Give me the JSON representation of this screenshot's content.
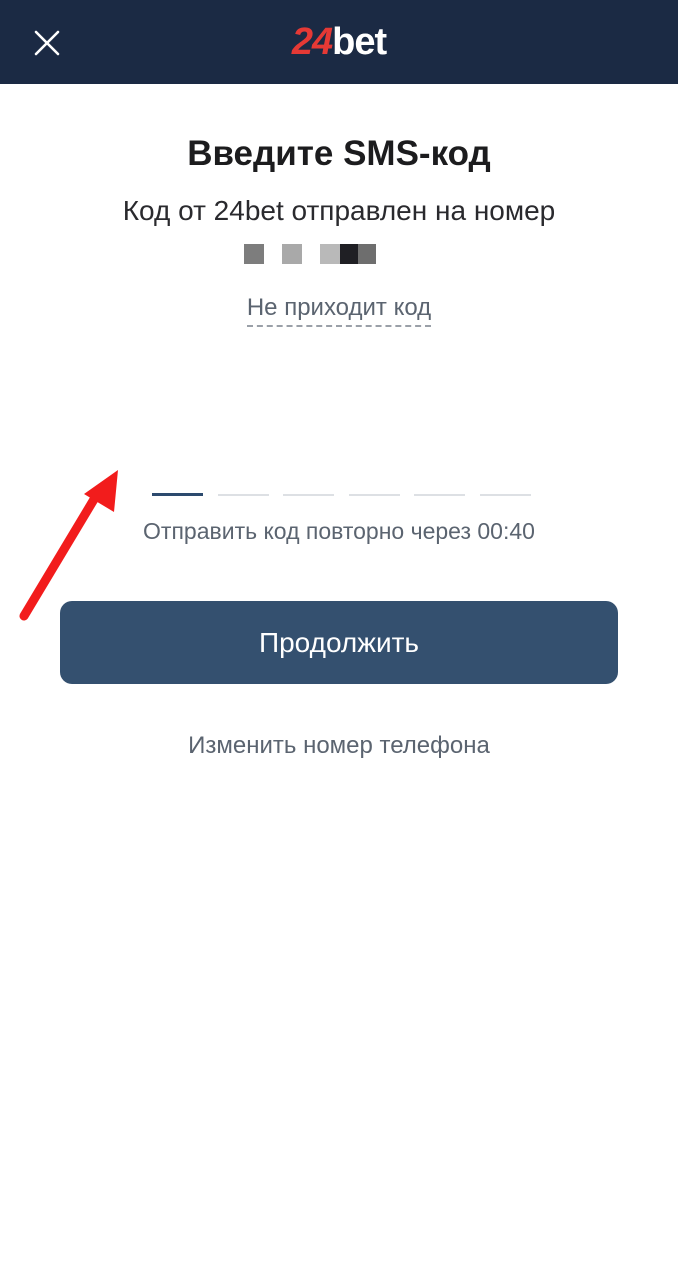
{
  "header": {
    "close_icon": "close-icon",
    "logo": {
      "num": "24",
      "word": "bet"
    },
    "colors": {
      "bar": "#1b2a44",
      "logo_num": "#e53935"
    }
  },
  "main": {
    "title": "Введите SMS-код",
    "subtitle": "Код от 24bet отправлен на номер",
    "no_code_link": "Не приходит код",
    "code_length": 6,
    "resend_text": "Отправить код повторно через 00:40",
    "continue_label": "Продолжить",
    "change_phone_label": "Изменить номер телефона",
    "colors": {
      "button": "#34506f",
      "active_slot": "#2c4a6e"
    }
  },
  "annotation": {
    "arrow_color": "#f21c1c"
  }
}
